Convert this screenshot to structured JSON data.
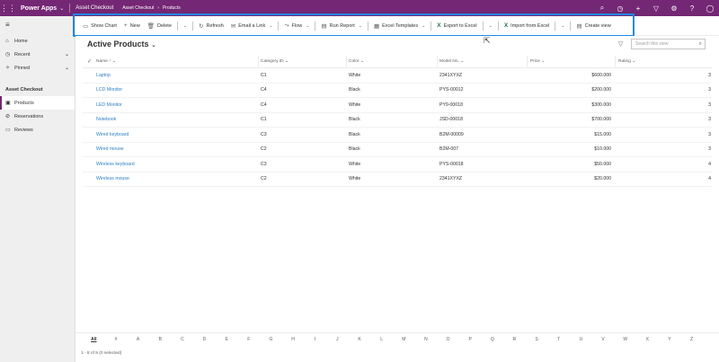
{
  "topbar": {
    "app_name": "Power Apps",
    "env_name": "Asset Checkout",
    "breadcrumb": [
      "Asset Checkout",
      "Products"
    ],
    "icons": [
      "search-icon",
      "assistant-icon",
      "add-icon",
      "filter-icon",
      "settings-icon",
      "help-icon",
      "avatar-icon"
    ]
  },
  "leftnav": {
    "items": [
      {
        "label": "Home",
        "icon": "home-icon"
      },
      {
        "label": "Recent",
        "icon": "clock-icon"
      },
      {
        "label": "Pinned",
        "icon": "pin-icon"
      }
    ],
    "area_title": "Asset Checkout",
    "area_items": [
      {
        "label": "Products",
        "icon": "products-icon",
        "active": true
      },
      {
        "label": "Reservations",
        "icon": "reservations-icon",
        "active": false
      },
      {
        "label": "Reviews",
        "icon": "reviews-icon",
        "active": false
      }
    ]
  },
  "commandbar": {
    "show_chart": "Show Chart",
    "new": "New",
    "delete": "Delete",
    "refresh": "Refresh",
    "email_link": "Email a Link",
    "flow": "Flow",
    "run_report": "Run Report",
    "excel_templates": "Excel Templates",
    "export_excel": "Export to Excel",
    "import_excel": "Import from Excel",
    "create_view": "Create view"
  },
  "view": {
    "title": "Active Products",
    "search_placeholder": "Search this view"
  },
  "grid": {
    "columns": {
      "name": "Name ↑",
      "category": "Category ID",
      "color": "Color",
      "model": "Model No.",
      "price": "Price",
      "rating": "Rating"
    },
    "rows": [
      {
        "name": "Laptop",
        "category": "C1",
        "color": "White",
        "model": "2341XYXZ",
        "price": "$600.000",
        "rating": "3"
      },
      {
        "name": "LCD Monitor",
        "category": "C4",
        "color": "Black",
        "model": "PYS-00012",
        "price": "$200.000",
        "rating": "3"
      },
      {
        "name": "LED Monitor",
        "category": "C4",
        "color": "White",
        "model": "PY9-00018",
        "price": "$300.000",
        "rating": "3"
      },
      {
        "name": "Notebook",
        "category": "C1",
        "color": "Black",
        "model": "JSD-00018",
        "price": "$700.000",
        "rating": "3"
      },
      {
        "name": "Wired keyboard",
        "category": "C3",
        "color": "Black",
        "model": "B2M-00009",
        "price": "$15.000",
        "rating": "3"
      },
      {
        "name": "Wired mouse",
        "category": "C2",
        "color": "Black",
        "model": "B2M-007",
        "price": "$10.000",
        "rating": "3"
      },
      {
        "name": "Wireless keyboard",
        "category": "C3",
        "color": "White",
        "model": "PYS-00018",
        "price": "$50.000",
        "rating": "4"
      },
      {
        "name": "Wireless mouse",
        "category": "C2",
        "color": "White",
        "model": "2341XYXZ",
        "price": "$20.000",
        "rating": "4"
      }
    ]
  },
  "jumpbar": [
    "All",
    "#",
    "A",
    "B",
    "C",
    "D",
    "E",
    "F",
    "G",
    "H",
    "I",
    "J",
    "K",
    "L",
    "M",
    "N",
    "O",
    "P",
    "Q",
    "R",
    "S",
    "T",
    "U",
    "V",
    "W",
    "X",
    "Y",
    "Z"
  ],
  "footer": {
    "status": "1 - 8 of 8 (0 selected)"
  },
  "colors": {
    "topbar": "#742774",
    "highlight": "#1e88e5",
    "link": "#2b7fc2"
  }
}
